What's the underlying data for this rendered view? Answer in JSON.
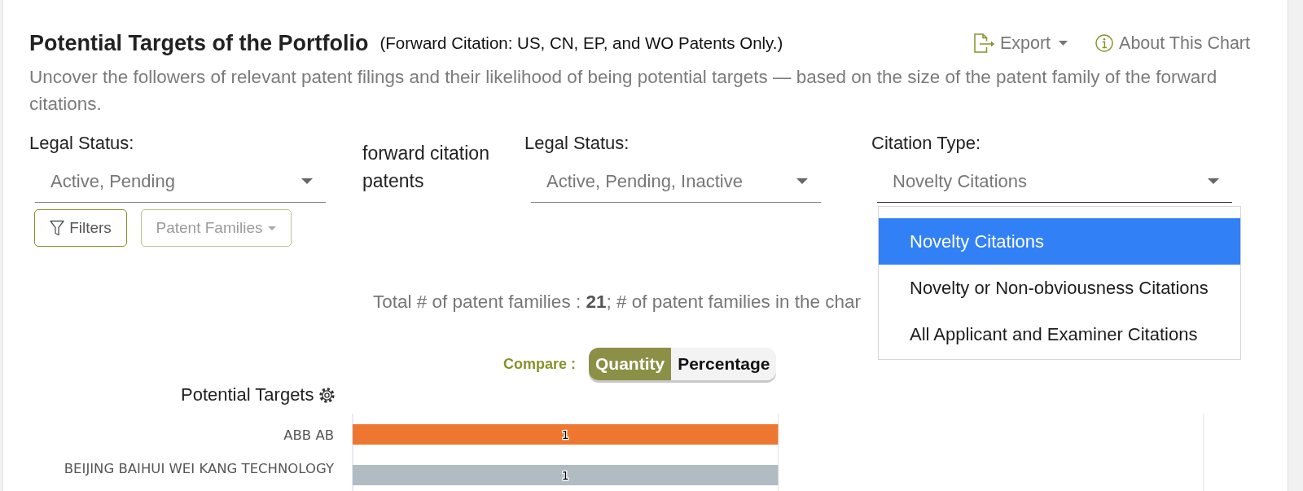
{
  "header": {
    "title": "Potential Targets of the Portfolio",
    "note": "(Forward Citation: US, CN, EP, and WO Patents Only.)",
    "actions": [
      {
        "kind": "export",
        "label": "Export"
      },
      {
        "kind": "info",
        "label": "About This Chart"
      }
    ]
  },
  "description": "Uncover the followers of relevant patent filings and their likelihood of being potential targets — based on the size of the patent family of the forward citations.",
  "filters": [
    {
      "kind": "select",
      "label": "Legal Status:",
      "value": "Active, Pending",
      "expanded": false
    },
    {
      "kind": "text",
      "text": "forward citation patents"
    },
    {
      "kind": "select",
      "label": "Legal Status:",
      "value": "Active, Pending, Inactive",
      "expanded": false
    },
    {
      "kind": "select",
      "label": "Citation Type:",
      "value": "Novelty Citations",
      "expanded": true,
      "options": [
        {
          "label": "Novelty Citations",
          "selected": true
        },
        {
          "label": "Novelty or Non-obviousness Citations",
          "selected": false
        },
        {
          "label": "All Applicant and Examiner Citations",
          "selected": false
        }
      ]
    }
  ],
  "buttons": [
    {
      "kind": "filter",
      "label": "Filters",
      "disabled": false
    },
    {
      "kind": "dropdown",
      "label": "Patent Families",
      "disabled": true
    }
  ],
  "summary": "Total # of patent families : **21**; # of patent families in the char",
  "compare": {
    "label": "Compare :",
    "options": [
      {
        "label": "Quantity",
        "selected": true
      },
      {
        "label": "Percentage",
        "selected": false
      }
    ]
  },
  "chart": {
    "title": "Potential Targets",
    "chart_data": {
      "type": "bar",
      "orientation": "horizontal",
      "categories": [
        "ABB AB",
        "BEIJING BAIHUI WEI KANG TECHNOLOGY"
      ],
      "series": [
        {
          "color": "#ed7731",
          "values": [
            1,
            null
          ]
        },
        {
          "color": "#b1bcc2",
          "values": [
            null,
            1
          ]
        }
      ],
      "data_labels": true
    }
  }
}
